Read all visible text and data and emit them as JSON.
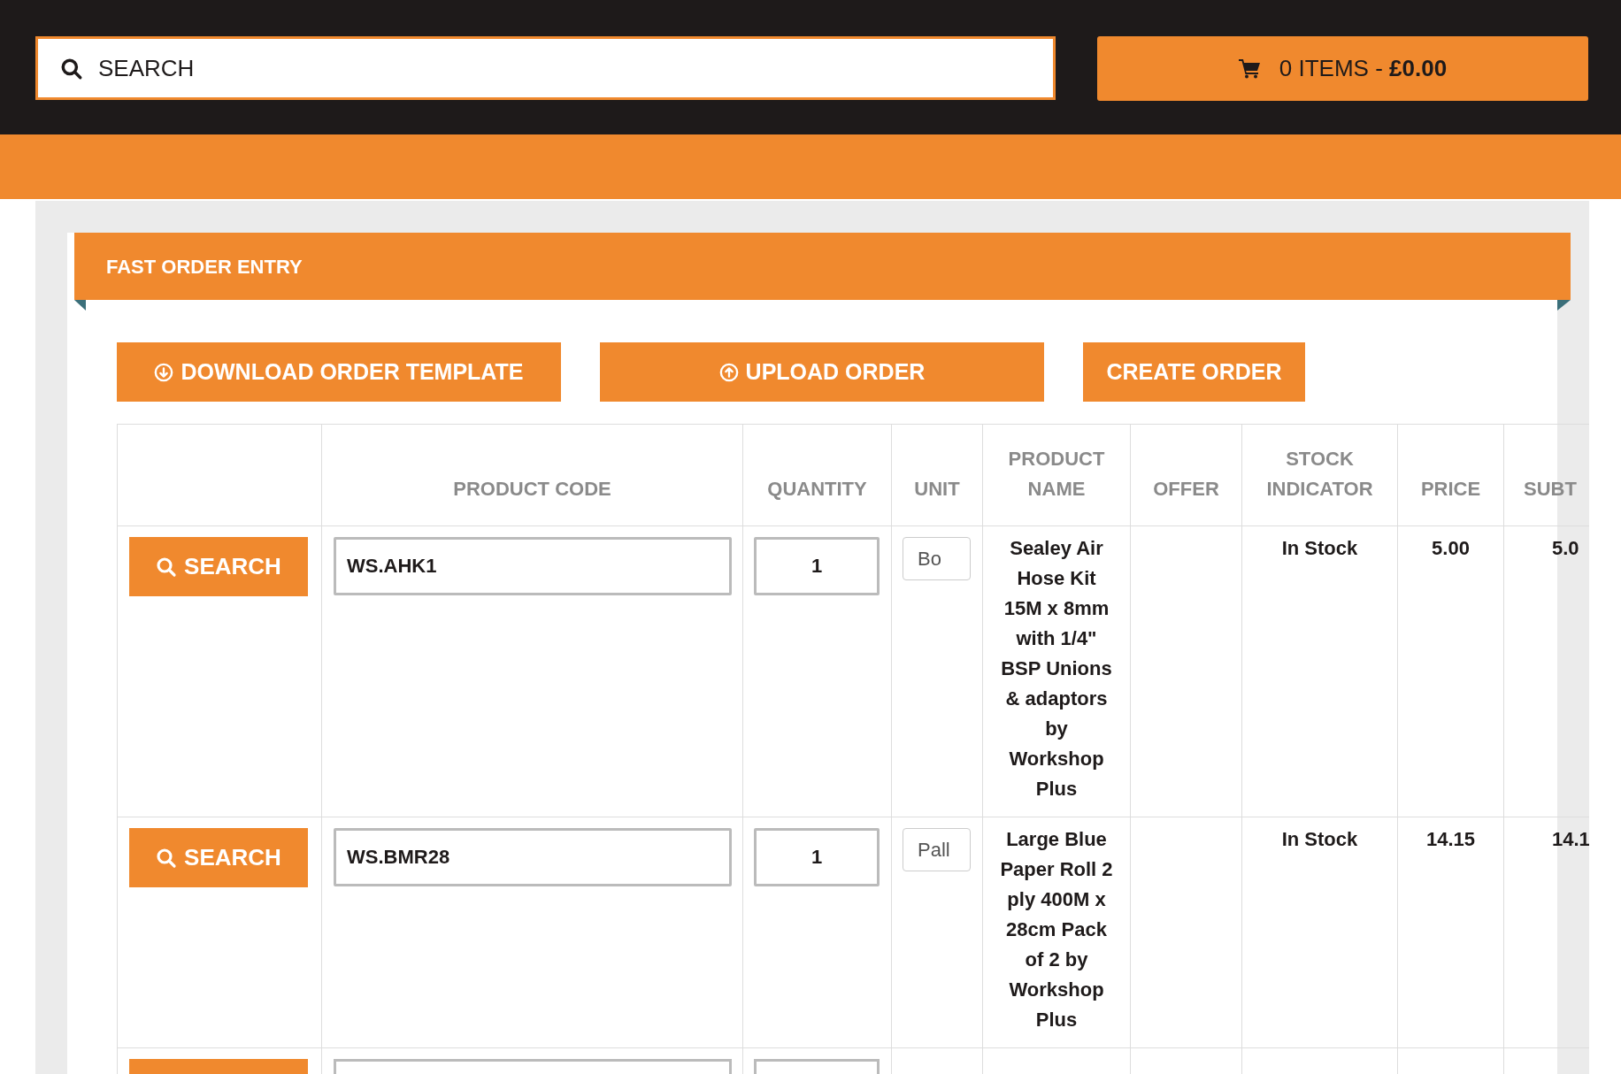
{
  "header": {
    "search": {
      "placeholder": "SEARCH"
    },
    "cart": {
      "label": "0 ITEMS - **£0.00**"
    }
  },
  "panel": {
    "title": "FAST ORDER ENTRY",
    "actions": [
      {
        "label": "DOWNLOAD ORDER TEMPLATE",
        "kind": "download"
      },
      {
        "label": "UPLOAD ORDER",
        "kind": "upload"
      },
      {
        "label": "CREATE ORDER",
        "kind": "plain"
      }
    ],
    "table": {
      "columns": [
        "PRODUCT CODE",
        "QUANTITY",
        "UNIT",
        "PRODUCT NAME",
        "OFFER",
        "STOCK INDICATOR",
        "PRICE",
        "SUBT"
      ],
      "rows": [
        {
          "search": "SEARCH",
          "code": "WS.AHK1",
          "quantity": "1",
          "unit": "Bo",
          "name": "Sealey Air Hose Kit 15M x 8mm with 1/4\" BSP Unions & adaptors by Workshop Plus",
          "stock": "In Stock",
          "price": "5.00",
          "subtotal": "5.0"
        },
        {
          "search": "SEARCH",
          "code": "WS.BMR28",
          "quantity": "1",
          "unit": "Pall",
          "name": "Large Blue Paper Roll 2 ply 400M x 28cm Pack of 2 by Workshop Plus",
          "stock": "In Stock",
          "price": "14.15",
          "subtotal": "14.1"
        }
      ]
    }
  }
}
